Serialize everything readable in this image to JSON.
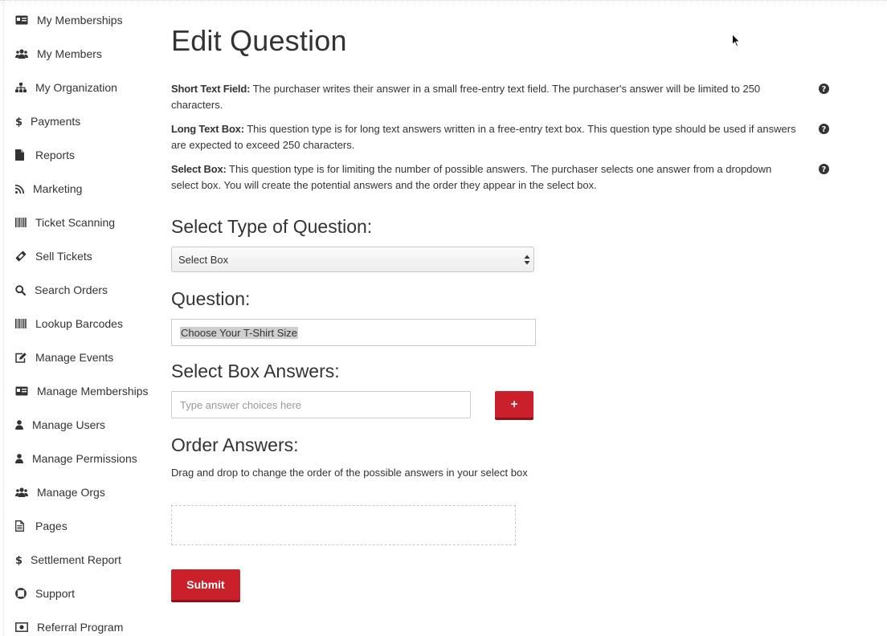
{
  "sidebar": {
    "items": [
      {
        "label": "My Memberships",
        "icon": "id-card-icon"
      },
      {
        "label": "My Members",
        "icon": "users-icon"
      },
      {
        "label": "My Organization",
        "icon": "sitemap-icon"
      },
      {
        "label": "Payments",
        "icon": "dollar-icon"
      },
      {
        "label": "Reports",
        "icon": "file-icon"
      },
      {
        "label": "Marketing",
        "icon": "rss-icon"
      },
      {
        "label": "Ticket Scanning",
        "icon": "barcode-icon"
      },
      {
        "label": "Sell Tickets",
        "icon": "ticket-icon"
      },
      {
        "label": "Search Orders",
        "icon": "search-icon"
      },
      {
        "label": "Lookup Barcodes",
        "icon": "barcode-icon"
      },
      {
        "label": "Manage Events",
        "icon": "edit-icon"
      },
      {
        "label": "Manage Memberships",
        "icon": "id-card-icon"
      },
      {
        "label": "Manage Users",
        "icon": "user-icon"
      },
      {
        "label": "Manage Permissions",
        "icon": "user-icon"
      },
      {
        "label": "Manage Orgs",
        "icon": "users-icon"
      },
      {
        "label": "Pages",
        "icon": "file-text-icon"
      },
      {
        "label": "Settlement Report",
        "icon": "dollar-icon"
      },
      {
        "label": "Support",
        "icon": "life-ring-icon"
      },
      {
        "label": "Referral Program",
        "icon": "money-icon"
      }
    ]
  },
  "main": {
    "title": "Edit Question",
    "question_types": [
      {
        "name": "Short Text Field:",
        "description": "The purchaser writes their answer in a small free-entry text field. The purchaser's answer will be limited to 250 characters."
      },
      {
        "name": "Long Text Box:",
        "description": "This question type is for long text answers written in a free-entry text box. This question type should be used if answers are expected to exceed 250 characters."
      },
      {
        "name": "Select Box:",
        "description": "This question type is for limiting the number of possible answers. The purchaser selects one answer from a dropdown select box. You will create the potential answers and the order they appear in the select box."
      }
    ],
    "type_section": {
      "label": "Select Type of Question:",
      "selected": "Select Box"
    },
    "question_section": {
      "label": "Question:",
      "value": "Choose Your T-Shirt Size"
    },
    "answers_section": {
      "label": "Select Box Answers:",
      "placeholder": "Type answer choices here",
      "add_label": "+"
    },
    "order_section": {
      "label": "Order Answers:",
      "hint": "Drag and drop to change the order of the possible answers in your select box"
    },
    "submit_label": "Submit"
  },
  "colors": {
    "primary_button": "#c9202b",
    "text": "#333333"
  }
}
